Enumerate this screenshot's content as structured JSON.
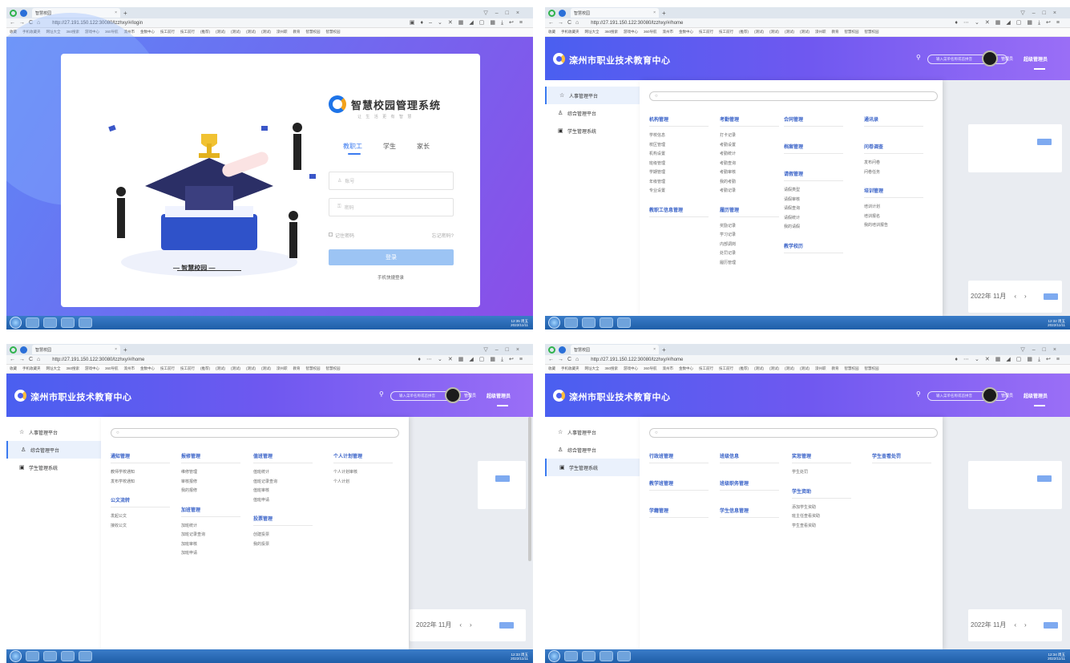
{
  "browser": {
    "tab_title": "智慧校园",
    "url_login": "http://27.191.150.122:30080/lzzhxy/#/login",
    "url_home": "http://27.191.150.122:30080/lzzhxy/#/home"
  },
  "bookmarks": [
    "收藏",
    "手机收藏夹",
    "网址大全",
    "360搜索",
    "游戏中心",
    "360导航",
    "滦州市",
    "金数中心",
    "技工前行",
    "技工前行",
    "(推荐)",
    "(测试)",
    "(测试)",
    "(测试)",
    "(测试)",
    "滦州职",
    "教育",
    "智慧校园",
    "智慧校园"
  ],
  "login": {
    "brand": "智慧校园管理系统",
    "brand_sub": "让 生 活 更 有 智 慧",
    "illustration_caption": "— 智慧校园 —",
    "tabs": [
      "教职工",
      "学生",
      "家长"
    ],
    "account_placeholder": "账号",
    "password_placeholder": "密码",
    "remember": "记住密码",
    "forgot": "忘记密码?",
    "login_button": "登录",
    "mobile_login": "手机快捷登录"
  },
  "home": {
    "title": "滦州市职业技术教育中心",
    "search_placeholder": "输入菜单名称或首拼音",
    "user": "管理员",
    "role": "超级管理员",
    "sidebar": [
      "人事管理平台",
      "综合管理平台",
      "学生管理系统"
    ],
    "date": "2022年 11月",
    "more": "更多"
  },
  "menus": {
    "hr": [
      {
        "title": "机构管理",
        "items": [
          "学校信息",
          "校区管理",
          "机构设置",
          "班级管理",
          "学期管理",
          "年级管理",
          "专业设置"
        ]
      },
      {
        "title": "教职工信息管理",
        "items": []
      },
      {
        "title": "考勤管理",
        "items": [
          "打卡记录",
          "考勤设置",
          "考勤统计",
          "考勤查询",
          "考勤审核",
          "我的考勤",
          "考勤记录"
        ]
      },
      {
        "title": "履历管理",
        "items": [
          "奖励记录",
          "学习记录",
          "内部调岗",
          "处罚记录",
          "履历管理"
        ]
      },
      {
        "title": "合同管理",
        "items": []
      },
      {
        "title": "档案管理",
        "items": []
      },
      {
        "title": "请假管理",
        "items": [
          "请假类型",
          "请假审核",
          "请假查询",
          "请假统计",
          "我的请假"
        ]
      },
      {
        "title": "教学校历",
        "items": []
      },
      {
        "title": "通讯录",
        "items": []
      },
      {
        "title": "问卷调查",
        "items": [
          "发布问卷",
          "问卷任务"
        ]
      },
      {
        "title": "培训管理",
        "items": [
          "培训计划",
          "培训报名",
          "我的培训报告"
        ]
      }
    ],
    "general": [
      {
        "title": "通知管理",
        "items": [
          "教师学校通知",
          "发布学校通知"
        ]
      },
      {
        "title": "公文流转",
        "items": [
          "发起公文",
          "接收公文"
        ]
      },
      {
        "title": "报修管理",
        "items": [
          "维修管理",
          "审核报修",
          "我的报修"
        ]
      },
      {
        "title": "加班管理",
        "items": [
          "加班统计",
          "加班记录查询",
          "加班审核",
          "加班申请"
        ]
      },
      {
        "title": "值班管理",
        "items": [
          "值班统计",
          "值班记录查询",
          "值班审核",
          "值班申请"
        ]
      },
      {
        "title": "投票管理",
        "items": [
          "创建投票",
          "我的投票"
        ]
      },
      {
        "title": "个人计划管理",
        "items": [
          "个人计划审核",
          "个人计划"
        ]
      }
    ],
    "student": [
      {
        "title": "行政班管理",
        "items": []
      },
      {
        "title": "教学班管理",
        "items": []
      },
      {
        "title": "学籍管理",
        "items": []
      },
      {
        "title": "班级信息",
        "items": []
      },
      {
        "title": "班级职务管理",
        "items": []
      },
      {
        "title": "学生信息管理",
        "items": []
      },
      {
        "title": "奖惩管理",
        "items": [
          "学生处罚"
        ]
      },
      {
        "title": "学生资助",
        "items": [
          "添加学生资助",
          "班主任查看资助",
          "学生查看资助"
        ]
      },
      {
        "title": "学生查看处罚",
        "items": []
      }
    ]
  },
  "taskbar": {
    "clock1": "12:35 周五\n2022/11/11",
    "clock2": "12:32 周五\n2022/11/11",
    "clock3": "12:33 周五\n2022/11/11",
    "clock4": "12:34 周五\n2022/11/11"
  }
}
